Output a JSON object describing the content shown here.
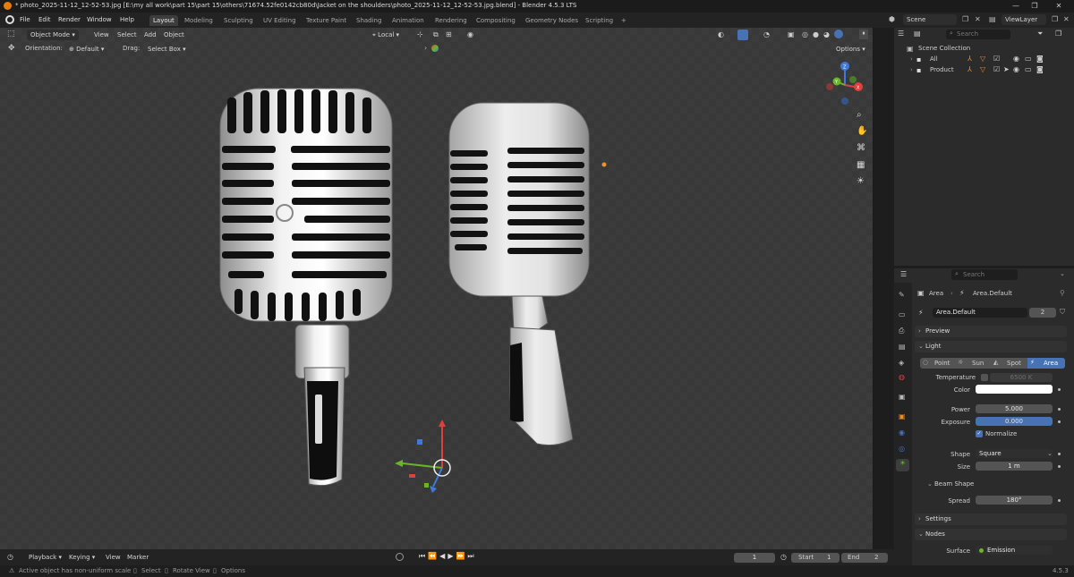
{
  "window": {
    "title": "* photo_2025-11-12_12-52-53.jpg [E:\\my all work\\part 15\\part 15\\others\\71674.52fe0142cb80d\\Jacket on the shoulders\\photo_2025-11-12_12-52-53.jpg.blend] - Blender 4.5.3 LTS",
    "min": "—",
    "max": "❐",
    "close": "✕"
  },
  "menu": [
    "File",
    "Edit",
    "Render",
    "Window",
    "Help"
  ],
  "workspaces": [
    "Layout",
    "Modeling",
    "Sculpting",
    "UV Editing",
    "Texture Paint",
    "Shading",
    "Animation",
    "Rendering",
    "Compositing",
    "Geometry Nodes",
    "Scripting"
  ],
  "active_workspace": "Layout",
  "add_workspace": "+",
  "scene": {
    "label": "Scene",
    "view_layer": "ViewLayer"
  },
  "viewport_header": {
    "mode": "Object Mode",
    "menus": [
      "View",
      "Select",
      "Add",
      "Object"
    ],
    "transform": "Local"
  },
  "tool_header": {
    "orientation_label": "Orientation:",
    "orientation_value": "Default",
    "drag_label": "Drag:",
    "drag_value": "Select Box",
    "options": "Options"
  },
  "gizmo": {
    "x": "X",
    "y": "Y",
    "z": "Z"
  },
  "outliner": {
    "search_placeholder": "Search",
    "root": "Scene Collection",
    "items": [
      "All",
      "Product"
    ]
  },
  "properties": {
    "search_placeholder": "Search",
    "breadcrumb": [
      "Area",
      "Area.Default"
    ],
    "datablock": "Area.Default",
    "users": "2",
    "preview": "Preview",
    "light_panel": "Light",
    "light_types": [
      "Point",
      "Sun",
      "Spot",
      "Area"
    ],
    "active_light_type": "Area",
    "temperature_label": "Temperature",
    "temperature_value": "6500 K",
    "color_label": "Color",
    "color_value": "#ffffff",
    "power_label": "Power",
    "power_value": "5.000",
    "exposure_label": "Exposure",
    "exposure_value": "0.000",
    "normalize": "Normalize",
    "shape_label": "Shape",
    "shape_value": "Square",
    "size_label": "Size",
    "size_value": "1 m",
    "beam_panel": "Beam Shape",
    "spread_label": "Spread",
    "spread_value": "180°",
    "settings_panel": "Settings",
    "nodes_panel": "Nodes",
    "surface_label": "Surface",
    "surface_value": "Emission"
  },
  "timeline": {
    "menus": [
      "Playback",
      "Keying",
      "View",
      "Marker"
    ],
    "current_frame": "1",
    "start_label": "Start",
    "start_value": "1",
    "end_label": "End",
    "end_value": "2"
  },
  "status": {
    "message": "Active object has non-uniform scale",
    "select": "Select",
    "rotate": "Rotate View",
    "options": "Options",
    "version": "4.5.3"
  },
  "colors": {
    "accent": "#4772b3",
    "bg": "#393939",
    "panel": "#2b2b2b"
  }
}
